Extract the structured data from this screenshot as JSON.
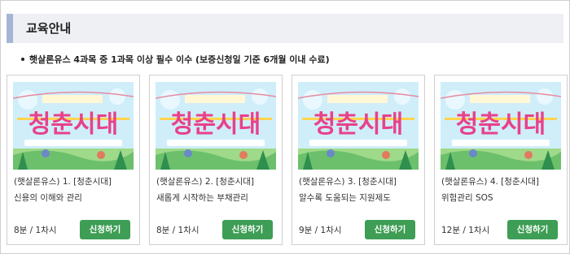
{
  "section": {
    "title": "교육안내"
  },
  "notice": "햇살론유스 4과목 중 1과목 이상 필수 이수 (보증신청일 기준 6개월 이내 수료)",
  "courses": [
    {
      "title_line1": "(햇살론유스) 1. [청춘시대]",
      "title_line2": "신용의 이해와 관리",
      "duration": "8분 / 1차시",
      "button": "신청하기",
      "thumbnail_text": "청춘시대"
    },
    {
      "title_line1": "(햇살론유스) 2. [청춘시대]",
      "title_line2": "새롭게 시작하는 부채관리",
      "duration": "8분 / 1차시",
      "button": "신청하기",
      "thumbnail_text": "청춘시대"
    },
    {
      "title_line1": "(햇살론유스) 3. [청춘시대]",
      "title_line2": "알수록 도움되는 지원제도",
      "duration": "9분 / 1차시",
      "button": "신청하기",
      "thumbnail_text": "청춘시대"
    },
    {
      "title_line1": "(햇살론유스) 4. [청춘시대]",
      "title_line2": "위험관리 SOS",
      "duration": "12분 / 1차시",
      "button": "신청하기",
      "thumbnail_text": "청춘시대"
    }
  ],
  "colors": {
    "button": "#3e9e55",
    "header_accent": "#a6b4d6",
    "header_bg": "#eef0f3",
    "thumb_sky": "#cfeefa",
    "thumb_title": "#e8418a"
  }
}
